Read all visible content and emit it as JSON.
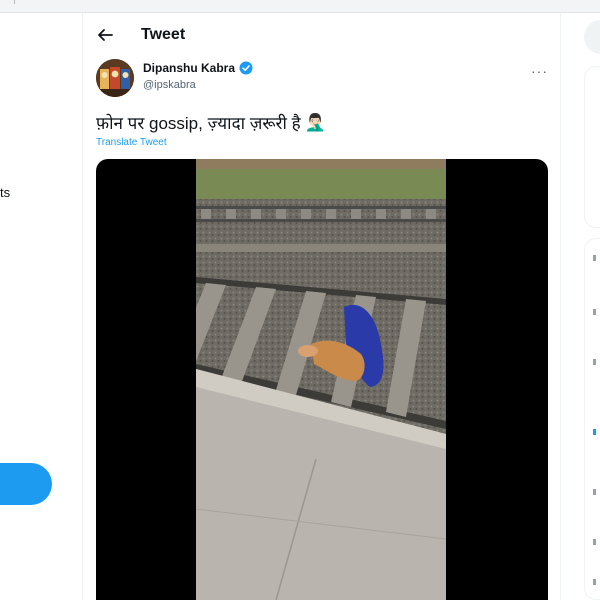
{
  "browser": {
    "tabs_text": "···  |  ···  ·  ·  ···"
  },
  "nav": {
    "partial_label": "ts"
  },
  "header": {
    "title": "Tweet"
  },
  "tweet": {
    "author_name": "Dipanshu Kabra",
    "author_handle": "@ipskabra",
    "text": "फ़ोन पर gossip, ज़्यादा ज़रूरी है",
    "emoji": "🤦🏻‍♂️",
    "translate_label": "Translate Tweet",
    "more_label": "···"
  },
  "colors": {
    "accent": "#1d9bf0",
    "muted": "#536471",
    "text": "#0f1419"
  }
}
